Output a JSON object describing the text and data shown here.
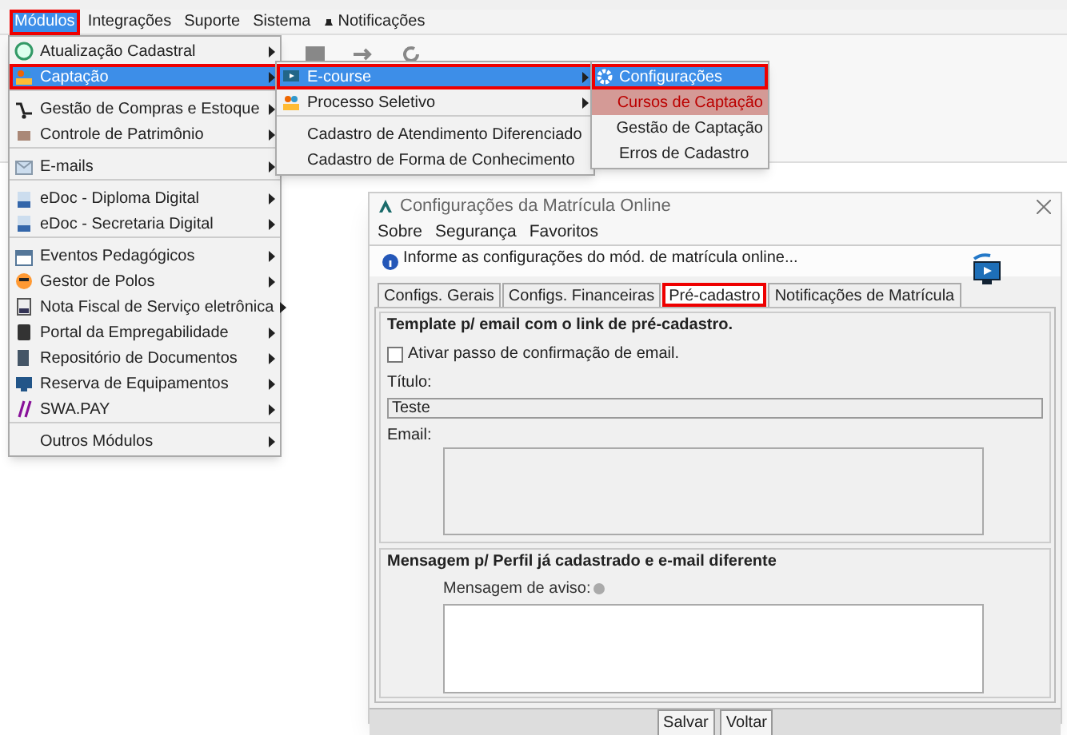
{
  "menubar": [
    {
      "label": "Módulos",
      "selected": true,
      "highlighted": true
    },
    {
      "label": "Integrações",
      "selected": false,
      "highlighted": false
    },
    {
      "label": "Suporte",
      "selected": false,
      "highlighted": false
    },
    {
      "label": "Sistema",
      "selected": false,
      "highlighted": false
    },
    {
      "label": "Notificações",
      "selected": false,
      "highlighted": false
    }
  ],
  "main_menu": [
    {
      "label": "Atualização Cadastral",
      "submenu": true,
      "selected": false,
      "highlighted": false,
      "separator_before": false
    },
    {
      "label": "Captação",
      "submenu": true,
      "selected": true,
      "highlighted": true,
      "separator_before": false
    },
    {
      "label": "Gestão de Compras e Estoque",
      "submenu": true,
      "selected": false,
      "highlighted": false,
      "separator_before": true
    },
    {
      "label": "Controle de Patrimônio",
      "submenu": true,
      "selected": false,
      "highlighted": false,
      "separator_before": false
    },
    {
      "label": "E-mails",
      "submenu": true,
      "selected": false,
      "highlighted": false,
      "separator_before": true
    },
    {
      "label": "eDoc - Diploma Digital",
      "submenu": true,
      "selected": false,
      "highlighted": false,
      "separator_before": true
    },
    {
      "label": "eDoc - Secretaria Digital",
      "submenu": true,
      "selected": false,
      "highlighted": false,
      "separator_before": false
    },
    {
      "label": "Eventos Pedagógicos",
      "submenu": true,
      "selected": false,
      "highlighted": false,
      "separator_before": true
    },
    {
      "label": "Gestor de Polos",
      "submenu": true,
      "selected": false,
      "highlighted": false,
      "separator_before": false
    },
    {
      "label": "Nota Fiscal de Serviço eletrônica",
      "submenu": true,
      "selected": false,
      "highlighted": false,
      "separator_before": false
    },
    {
      "label": "Portal da Empregabilidade",
      "submenu": true,
      "selected": false,
      "highlighted": false,
      "separator_before": false
    },
    {
      "label": "Repositório de Documentos",
      "submenu": true,
      "selected": false,
      "highlighted": false,
      "separator_before": false
    },
    {
      "label": "Reserva de Equipamentos",
      "submenu": true,
      "selected": false,
      "highlighted": false,
      "separator_before": false
    },
    {
      "label": "SWA.PAY",
      "submenu": true,
      "selected": false,
      "highlighted": false,
      "separator_before": false
    },
    {
      "label": "Outros Módulos",
      "submenu": true,
      "selected": false,
      "highlighted": false,
      "separator_before": true
    }
  ],
  "captacao_menu": [
    {
      "label": "E-course",
      "submenu": true,
      "selected": true,
      "highlighted": true,
      "separator_before": false
    },
    {
      "label": "Processo Seletivo",
      "submenu": true,
      "selected": false,
      "highlighted": false,
      "separator_before": false
    },
    {
      "label": "Cadastro de Atendimento Diferenciado",
      "submenu": false,
      "selected": false,
      "highlighted": false,
      "separator_before": true
    },
    {
      "label": "Cadastro de Forma de Conhecimento",
      "submenu": false,
      "selected": false,
      "highlighted": false,
      "separator_before": false
    }
  ],
  "ecourse_menu": [
    {
      "label": "Configurações",
      "selected": true,
      "highlighted": true,
      "kind": "normal"
    },
    {
      "label": "Cursos de Captação",
      "selected": false,
      "highlighted": false,
      "kind": "marked"
    },
    {
      "label": "Gestão de Captação",
      "selected": false,
      "highlighted": false,
      "kind": "normal"
    },
    {
      "label": "Erros de Cadastro",
      "selected": false,
      "highlighted": false,
      "kind": "normal"
    }
  ],
  "dialog": {
    "title": "Configurações da Matrícula Online",
    "menu": [
      "Sobre",
      "Segurança",
      "Favoritos"
    ],
    "info": "Informe as configurações do mód. de matrícula online...",
    "tabs": [
      {
        "label": "Configs. Gerais",
        "selected": false,
        "highlighted": false
      },
      {
        "label": "Configs. Financeiras",
        "selected": false,
        "highlighted": false
      },
      {
        "label": "Pré-cadastro",
        "selected": true,
        "highlighted": true
      },
      {
        "label": "Notificações de Matrícula",
        "selected": false,
        "highlighted": false
      }
    ],
    "template_group": {
      "title": "Template p/ email com o link de pré-cadastro.",
      "checkbox": {
        "label": "Ativar passo de confirmação de email.",
        "checked": false
      },
      "title_label": "Título:",
      "title_value": "Teste",
      "email_label": "Email:"
    },
    "message_group": {
      "title": "Mensagem p/ Perfil já cadastrado e e-mail diferente",
      "label": "Mensagem de aviso:"
    },
    "buttons": [
      "Salvar",
      "Voltar"
    ]
  }
}
